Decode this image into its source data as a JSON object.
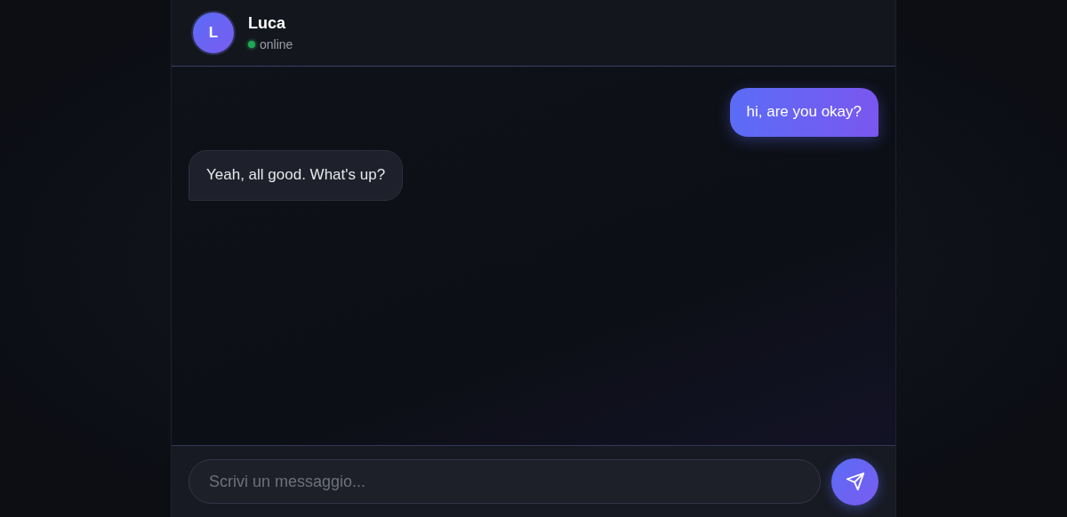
{
  "contact": {
    "avatar_letter": "L",
    "name": "Luca",
    "status": "online",
    "online": true
  },
  "messages": [
    {
      "kind": "sent",
      "text": "hi, are you okay?"
    },
    {
      "kind": "received",
      "text": "Yeah, all good. What's up?"
    }
  ],
  "composer": {
    "placeholder": "Scrivi un messaggio..."
  }
}
